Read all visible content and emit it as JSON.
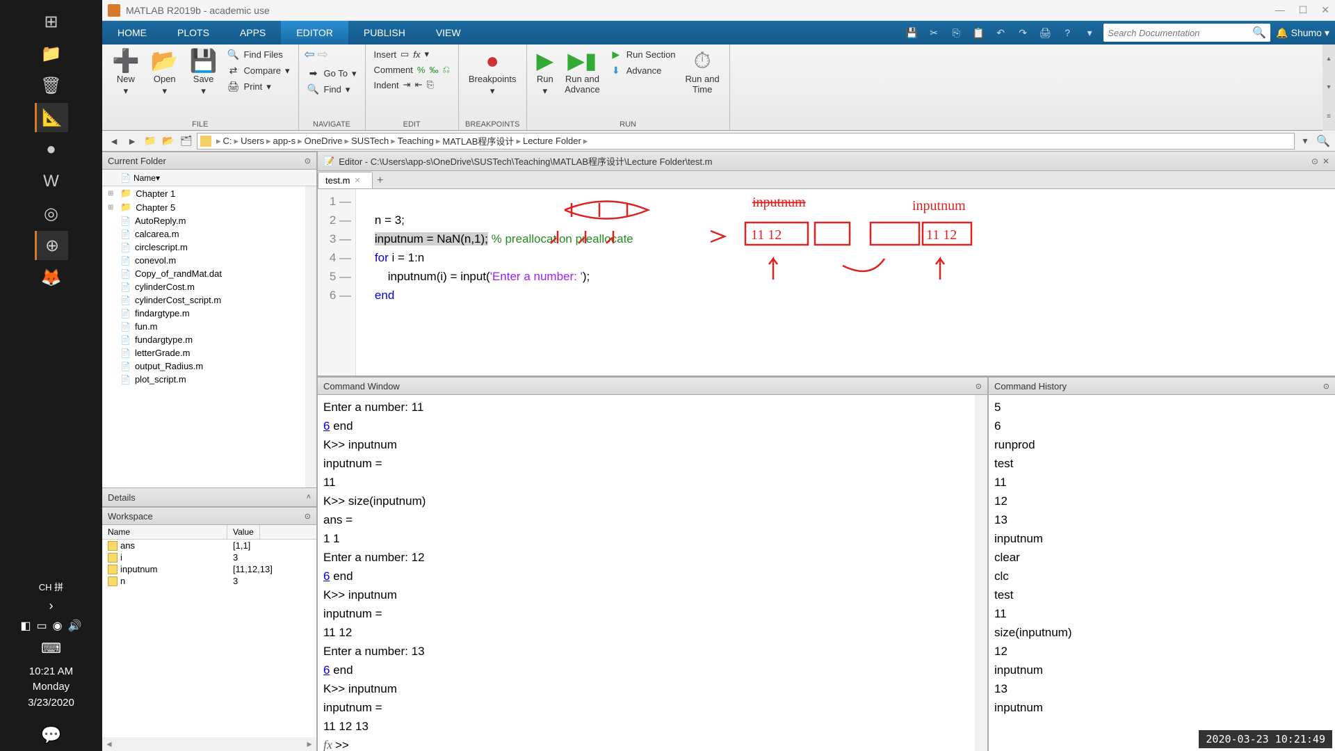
{
  "os": {
    "clock_time": "10:21 AM",
    "clock_day": "Monday",
    "clock_date": "3/23/2020",
    "input_ind": "CH 拼"
  },
  "title": "MATLAB R2019b - academic use",
  "tabs": [
    "HOME",
    "PLOTS",
    "APPS",
    "EDITOR",
    "PUBLISH",
    "VIEW"
  ],
  "active_tab": "EDITOR",
  "search_placeholder": "Search Documentation",
  "user": "Shumo",
  "toolstrip": {
    "file": {
      "new": "New",
      "open": "Open",
      "save": "Save",
      "find_files": "Find Files",
      "compare": "Compare",
      "print": "Print",
      "label": "FILE"
    },
    "navigate": {
      "goto": "Go To",
      "find": "Find",
      "label": "NAVIGATE"
    },
    "edit": {
      "insert": "Insert",
      "comment": "Comment",
      "indent": "Indent",
      "label": "EDIT"
    },
    "breakpoints": {
      "label_btn": "Breakpoints",
      "label": "BREAKPOINTS"
    },
    "run": {
      "run": "Run",
      "run_advance": "Run and\nAdvance",
      "run_section": "Run Section",
      "advance": "Advance",
      "run_time": "Run and\nTime",
      "label": "RUN"
    }
  },
  "address": [
    "C:",
    "Users",
    "app-s",
    "OneDrive",
    "SUSTech",
    "Teaching",
    "MATLAB程序设计",
    "Lecture Folder"
  ],
  "current_folder": {
    "title": "Current Folder",
    "col": "Name",
    "folders": [
      "Chapter 1",
      "Chapter 5"
    ],
    "files": [
      "AutoReply.m",
      "calcarea.m",
      "circlescript.m",
      "conevol.m",
      "Copy_of_randMat.dat",
      "cylinderCost.m",
      "cylinderCost_script.m",
      "findargtype.m",
      "fun.m",
      "fundargtype.m",
      "letterGrade.m",
      "output_Radius.m",
      "plot_script.m"
    ]
  },
  "details_title": "Details",
  "workspace": {
    "title": "Workspace",
    "head_name": "Name",
    "head_value": "Value",
    "vars": [
      {
        "n": "ans",
        "v": "[1,1]"
      },
      {
        "n": "i",
        "v": "3"
      },
      {
        "n": "inputnum",
        "v": "[11,12,13]"
      },
      {
        "n": "n",
        "v": "3"
      }
    ]
  },
  "editor": {
    "title": "Editor - C:\\Users\\app-s\\OneDrive\\SUSTech\\Teaching\\MATLAB程序设计\\Lecture Folder\\test.m",
    "tab": "test.m",
    "lines": [
      {
        "num": "1",
        "code": ""
      },
      {
        "num": "2",
        "code": "n = 3;"
      },
      {
        "num": "3",
        "code_hl": "inputnum = NaN(n,1);",
        "cmt": " % preallocation preallocate"
      },
      {
        "num": "4",
        "kw": "for",
        "code": " i = 1:n"
      },
      {
        "num": "5",
        "code": "    inputnum(i) = input(",
        "str": "'Enter a number: '",
        "code2": ");"
      },
      {
        "num": "6",
        "kw": "end",
        "code": ""
      }
    ]
  },
  "cmdwin": {
    "title": "Command Window",
    "lines": [
      {
        "t": "Enter a number: 11"
      },
      {
        "link": "6",
        "t": "    end"
      },
      {
        "t": "K>> inputnum"
      },
      {
        "t": "inputnum ="
      },
      {
        "t": "    11"
      },
      {
        "t": "K>> size(inputnum)"
      },
      {
        "t": "ans ="
      },
      {
        "t": "     1     1"
      },
      {
        "t": "Enter a number: 12"
      },
      {
        "link": "6",
        "t": "    end"
      },
      {
        "t": "K>> inputnum"
      },
      {
        "t": "inputnum ="
      },
      {
        "t": "    11    12"
      },
      {
        "t": "Enter a number: 13"
      },
      {
        "link": "6",
        "t": "    end"
      },
      {
        "t": "K>> inputnum"
      },
      {
        "t": "inputnum ="
      },
      {
        "t": "    11    12    13"
      }
    ],
    "prompt": ">>"
  },
  "history": {
    "title": "Command History",
    "items": [
      "5",
      "6",
      "runprod",
      "test",
      "11",
      "12",
      "13",
      "inputnum",
      "clear",
      "clc",
      "test",
      "11",
      "size(inputnum)",
      "12",
      "inputnum",
      "13",
      "inputnum"
    ]
  },
  "timestamp": "2020-03-23 10:21:49"
}
